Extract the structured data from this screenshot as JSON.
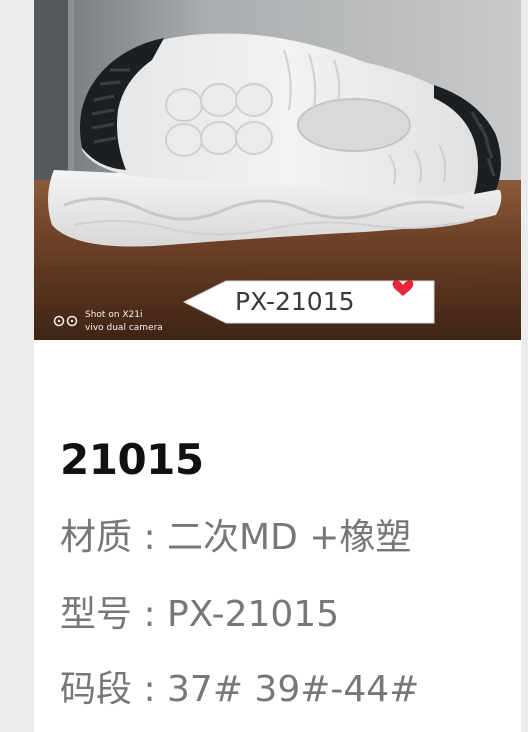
{
  "photo": {
    "tag_text": "PX-21015",
    "watermark_line1": "Shot on X21i",
    "watermark_line2": "vivo dual camera"
  },
  "product": {
    "title": "21015",
    "material": "材质 : 二次MD +橡塑",
    "model": "型号 : PX-21015",
    "sizes": "码段 : 37# 39#-44#"
  },
  "colors": {
    "page_bg": "#ececec",
    "card_bg": "#ffffff",
    "title": "#111111",
    "spec_text": "#777777",
    "tag_heart": "#e8253a"
  }
}
